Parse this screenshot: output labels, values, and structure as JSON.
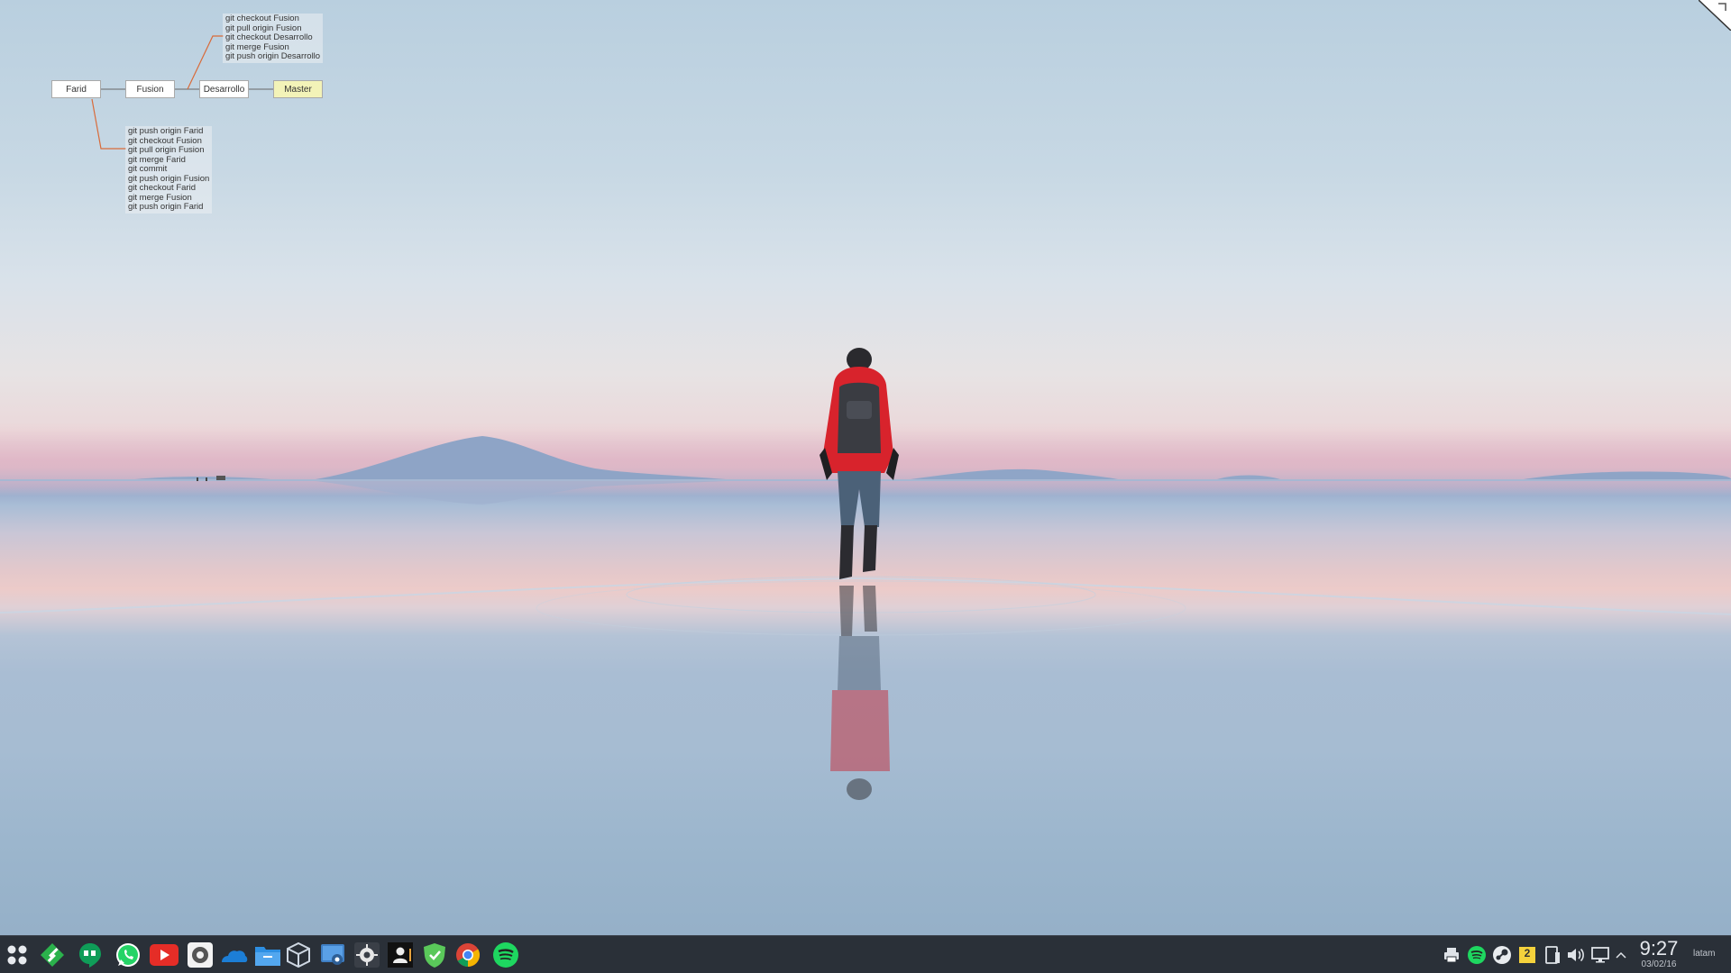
{
  "git_diagram": {
    "branches": [
      "Farid",
      "Fusion",
      "Desarrollo",
      "Master"
    ],
    "top_commands": [
      "git checkout Fusion",
      "git pull origin Fusion",
      "git checkout Desarrollo",
      "git merge Fusion",
      "git push origin Desarrollo"
    ],
    "bottom_commands": [
      "git push origin Farid",
      "git checkout Fusion",
      "git pull origin Fusion",
      "git merge Farid",
      "git commit",
      "git push origin Fusion",
      "git checkout Farid",
      "git merge Fusion",
      "git push origin Farid"
    ]
  },
  "taskbar": {
    "launchers": [
      {
        "icon": "app-grid-icon"
      },
      {
        "icon": "feedly-icon",
        "color": "#2bb24c"
      },
      {
        "icon": "hangouts-icon",
        "color": "#0f9d58"
      },
      {
        "icon": "whatsapp-icon",
        "color": "#25d366"
      },
      {
        "icon": "youtube-icon",
        "color": "#e52d27"
      },
      {
        "icon": "settings-icon"
      },
      {
        "icon": "onedrive-icon",
        "color": "#1c7ed6"
      },
      {
        "icon": "file-manager-icon",
        "color": "#2d8fe3"
      },
      {
        "icon": "virtualbox-icon"
      },
      {
        "icon": "remote-desktop-icon"
      },
      {
        "icon": "gear-tool-icon"
      },
      {
        "icon": "terminal-icon"
      },
      {
        "icon": "shield-icon",
        "color": "#5ac85a"
      },
      {
        "icon": "chrome-icon"
      },
      {
        "icon": "spotify-icon",
        "color": "#1ed760"
      }
    ],
    "tray": [
      {
        "icon": "printer-icon"
      },
      {
        "icon": "spotify-tray-icon",
        "color": "#1ed760"
      },
      {
        "icon": "steam-icon"
      },
      {
        "icon": "notification-badge-icon",
        "badge": "2",
        "color": "#f5d23c"
      },
      {
        "icon": "device-icon"
      },
      {
        "icon": "volume-icon"
      },
      {
        "icon": "display-icon"
      },
      {
        "icon": "expand-tray-icon"
      }
    ],
    "clock": {
      "time": "9:27",
      "date": "03/02/16"
    },
    "user": "latam"
  }
}
